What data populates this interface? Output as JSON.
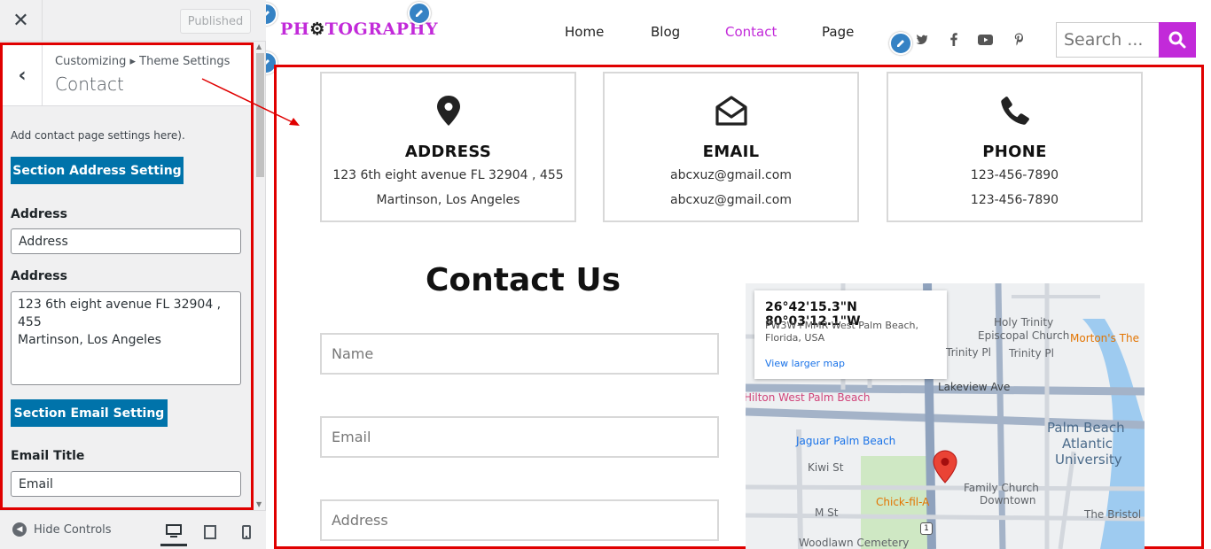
{
  "customizer": {
    "close_icon": "close-icon",
    "publish_label": "Published",
    "breadcrumb": "Customizing ▸ Theme Settings",
    "panel_title": "Contact",
    "description": "Add contact page settings here).",
    "section_address_btn": "Section Address Setting",
    "address_title_label": "Address",
    "address_title_value": "Address",
    "address_label": "Address",
    "address_value": "123 6th eight avenue FL 32904 , 455\nMartinson, Los Angeles",
    "section_email_btn": "Section Email Setting",
    "email_title_label": "Email Title",
    "email_title_value": "Email",
    "hide_controls": "Hide Controls",
    "devices": [
      "desktop",
      "tablet",
      "mobile"
    ],
    "accent_color": "#0073aa",
    "highlight_color": "#e00000"
  },
  "site": {
    "logo": {
      "pre": "PH",
      "cam": "⚙",
      "post": "TOGRAPHY"
    },
    "nav": [
      "Home",
      "Blog",
      "Contact",
      "Page"
    ],
    "active_nav": "Contact",
    "social_icons": [
      "twitter-icon",
      "facebook-icon",
      "youtube-icon",
      "pinterest-icon"
    ],
    "search_placeholder": "Search ...",
    "brand_color": "#c22ad9"
  },
  "info_cards": [
    {
      "title": "ADDRESS",
      "line1": "123 6th eight avenue FL 32904 , 455",
      "line2": "Martinson, Los Angeles",
      "icon": "map-pin-icon"
    },
    {
      "title": "EMAIL",
      "line1": "abcxuz@gmail.com",
      "line2": "abcxuz@gmail.com",
      "icon": "envelope-open-icon"
    },
    {
      "title": "PHONE",
      "line1": "123-456-7890",
      "line2": "123-456-7890",
      "icon": "phone-icon"
    }
  ],
  "contact": {
    "title": "Contact Us",
    "name_placeholder": "Name",
    "email_placeholder": "Email",
    "address_placeholder": "Address"
  },
  "map": {
    "coords": "26°42'15.3\"N 80°03'12.1\"W",
    "plus_code": "PW3W+MMR West Palm Beach, Florida, USA",
    "larger_map": "View larger map",
    "labels": {
      "trinity1": "Trinity Pl",
      "trinity2": "Trinity Pl",
      "holy1": "Holy Trinity",
      "holy2": "Episcopal Church",
      "mortons": "Morton's The",
      "lakeview": "Lakeview Ave",
      "hilton": "Hilton West Palm Beach",
      "pba1": "Palm Beach",
      "pba2": "Atlantic",
      "pba3": "University",
      "jaguar": "Jaguar Palm Beach",
      "kiwi": "Kiwi St",
      "family1": "Family Church",
      "family2": "Downtown",
      "chick": "Chick-fil-A",
      "mst": "M St",
      "bristol": "The Bristol",
      "woodlawn": "Woodlawn Cemetery",
      "route": "1"
    }
  }
}
